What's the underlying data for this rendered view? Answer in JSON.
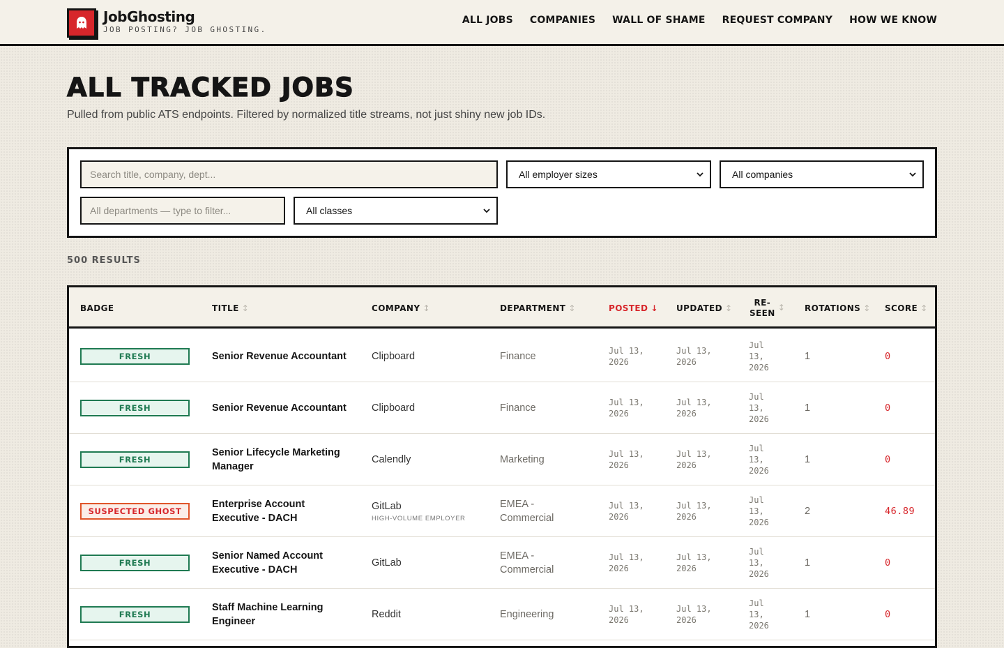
{
  "brand": {
    "name": "JobGhosting",
    "tagline": "JOB POSTING? JOB GHOSTING.",
    "logo_icon": "ghost-icon",
    "accent_color": "#d7262b"
  },
  "nav": {
    "items": [
      "ALL JOBS",
      "COMPANIES",
      "WALL OF SHAME",
      "REQUEST COMPANY",
      "HOW WE KNOW"
    ]
  },
  "page": {
    "title": "ALL TRACKED JOBS",
    "subtitle": "Pulled from public ATS endpoints. Filtered by normalized title streams, not just shiny new job IDs."
  },
  "filters": {
    "search_placeholder": "Search title, company, dept...",
    "employer_size": "All employer sizes",
    "company": "All companies",
    "department_placeholder": "All departments — type to filter...",
    "class": "All classes"
  },
  "results": {
    "count_label": "500 RESULTS"
  },
  "table": {
    "columns": {
      "badge": "BADGE",
      "title": "TITLE",
      "company": "COMPANY",
      "department": "DEPARTMENT",
      "posted": "POSTED",
      "updated": "UPDATED",
      "reseen_line1": "RE-",
      "reseen_line2": "SEEN",
      "rotations": "ROTATIONS",
      "score": "SCORE"
    },
    "sort_idle_glyph": "↕",
    "sort_active_glyph": "↓",
    "rows": [
      {
        "badge": "FRESH",
        "badge_type": "fresh",
        "title": "Senior Revenue Accountant",
        "company": "Clipboard",
        "company_note": "",
        "department": "Finance",
        "posted": "Jul 13,\n2026",
        "updated": "Jul 13,\n2026",
        "reseen": "Jul\n13,\n2026",
        "rotations": "1",
        "score": "0"
      },
      {
        "badge": "FRESH",
        "badge_type": "fresh",
        "title": "Senior Revenue Accountant",
        "company": "Clipboard",
        "company_note": "",
        "department": "Finance",
        "posted": "Jul 13,\n2026",
        "updated": "Jul 13,\n2026",
        "reseen": "Jul\n13,\n2026",
        "rotations": "1",
        "score": "0"
      },
      {
        "badge": "FRESH",
        "badge_type": "fresh",
        "title": "Senior Lifecycle Marketing Manager",
        "company": "Calendly",
        "company_note": "",
        "department": "Marketing",
        "posted": "Jul 13,\n2026",
        "updated": "Jul 13,\n2026",
        "reseen": "Jul\n13,\n2026",
        "rotations": "1",
        "score": "0"
      },
      {
        "badge": "SUSPECTED GHOST",
        "badge_type": "ghost",
        "title": "Enterprise Account Executive - DACH",
        "company": "GitLab",
        "company_note": "HIGH-VOLUME EMPLOYER",
        "department": "EMEA - Commercial",
        "posted": "Jul 13,\n2026",
        "updated": "Jul 13,\n2026",
        "reseen": "Jul\n13,\n2026",
        "rotations": "2",
        "score": "46.89"
      },
      {
        "badge": "FRESH",
        "badge_type": "fresh",
        "title": "Senior Named Account Executive - DACH",
        "company": "GitLab",
        "company_note": "",
        "department": "EMEA - Commercial",
        "posted": "Jul 13,\n2026",
        "updated": "Jul 13,\n2026",
        "reseen": "Jul\n13,\n2026",
        "rotations": "1",
        "score": "0"
      },
      {
        "badge": "FRESH",
        "badge_type": "fresh",
        "title": "Staff Machine Learning Engineer",
        "company": "Reddit",
        "company_note": "",
        "department": "Engineering",
        "posted": "Jul 13,\n2026",
        "updated": "Jul 13,\n2026",
        "reseen": "Jul\n13,\n2026",
        "rotations": "1",
        "score": "0"
      }
    ]
  }
}
